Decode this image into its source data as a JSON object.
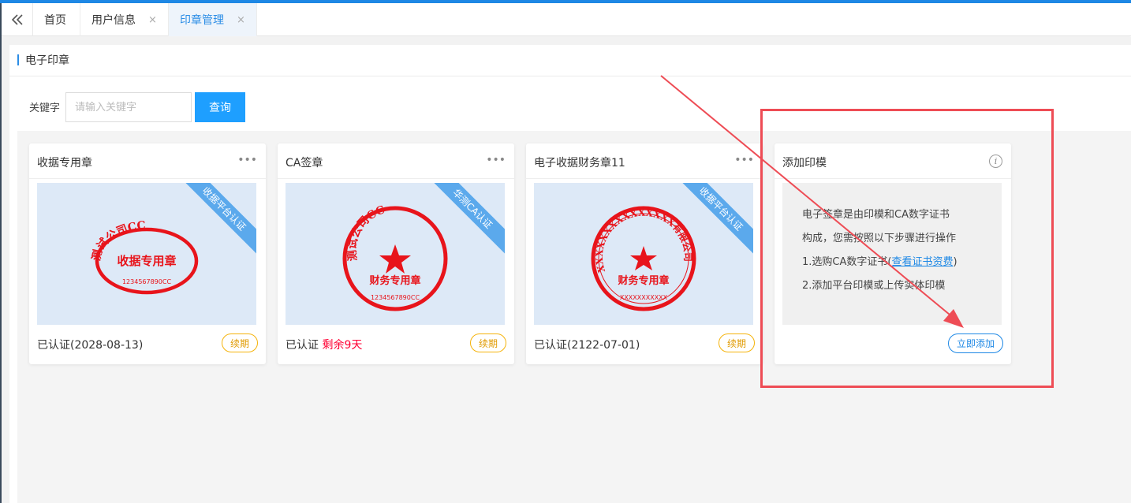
{
  "tabs": [
    {
      "label": "首页",
      "closable": false,
      "active": false
    },
    {
      "label": "用户信息",
      "closable": true,
      "active": false
    },
    {
      "label": "印章管理",
      "closable": true,
      "active": true
    }
  ],
  "tab_close_glyph": "×",
  "collapse_icon": "double-chevron-left-icon",
  "panel": {
    "title": "电子印章"
  },
  "search": {
    "label": "关键字",
    "placeholder": "请输入关键字",
    "button": "查询"
  },
  "cards": [
    {
      "title": "收据专用章",
      "menu": "•••",
      "ribbon": "收据平台认证",
      "status": "已认证(2028-08-13)",
      "status_warn": "",
      "renew": "续期",
      "seal": {
        "shape": "oval",
        "top_text": "测试公司CC",
        "center_text": "收据专用章",
        "bottom_text": "1234567890CC",
        "color": "#e8141b"
      }
    },
    {
      "title": "CA签章",
      "menu": "•••",
      "ribbon": "华测CA认证",
      "status": "已认证",
      "status_warn": "剩余9天",
      "renew": "续期",
      "seal": {
        "shape": "circle",
        "top_text": "测试公司CC",
        "center_text": "财务专用章",
        "bottom_text": "1234567890CC",
        "color": "#e8141b"
      }
    },
    {
      "title": "电子收据财务章11",
      "menu": "•••",
      "ribbon": "收据平台认证",
      "status": "已认证(2122-07-01)",
      "status_warn": "",
      "renew": "续期",
      "seal": {
        "shape": "circle",
        "top_text": "XXXXXXXXXXXXXXX有限公司",
        "center_text": "财务专用章",
        "bottom_text": "XXXXXXXXXXX",
        "color": "#e8141b"
      }
    }
  ],
  "add_card": {
    "title": "添加印模",
    "info_icon": "i",
    "lines": [
      "电子签章是由印模和CA数字证书",
      "构成，您需按照以下步骤进行操作",
      "1.选购CA数字证书(",
      "查看证书资费",
      ")",
      "2.添加平台印模或上传实体印模"
    ],
    "button": "立即添加"
  },
  "colors": {
    "accent": "#1e88e5",
    "button_primary": "#1e9fff",
    "seal_red": "#e8141b",
    "ribbon": "#5ba9ec",
    "renew": "#f5b30a",
    "annotation": "#ee4c55"
  }
}
